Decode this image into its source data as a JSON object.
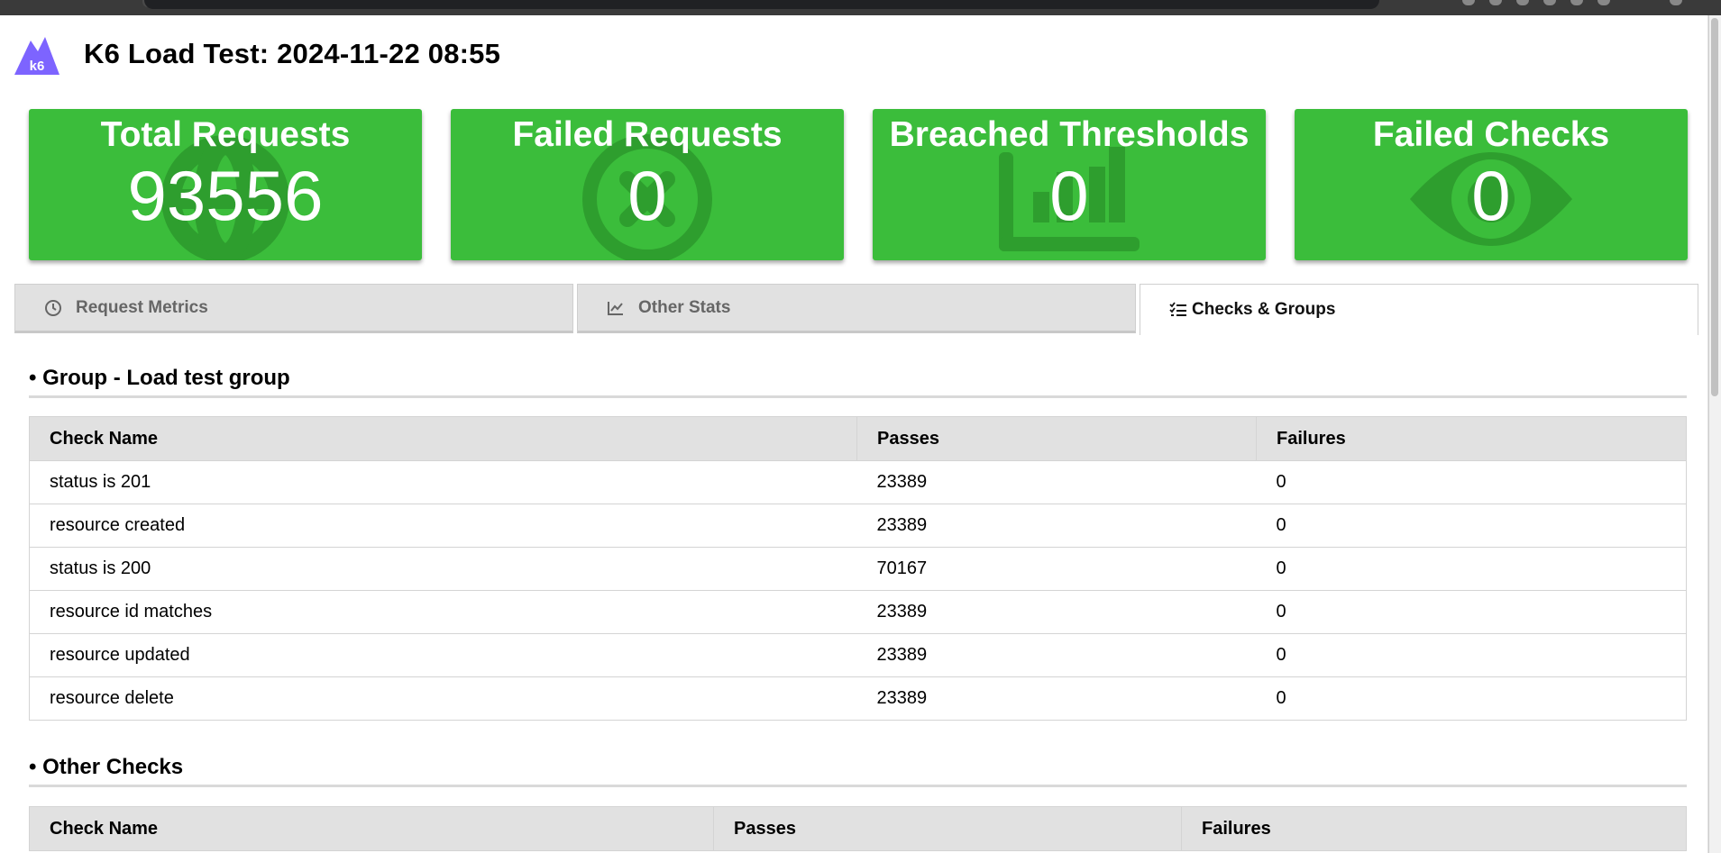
{
  "page": {
    "title": "K6 Load Test: 2024-11-22 08:55",
    "logo_text": "k6"
  },
  "colors": {
    "card_green": "#3bbd3b",
    "logo_purple": "#7d64ff"
  },
  "cards": [
    {
      "title": "Total Requests",
      "value": "93556",
      "icon": "globe-icon"
    },
    {
      "title": "Failed Requests",
      "value": "0",
      "icon": "x-circle-icon"
    },
    {
      "title": "Breached Thresholds",
      "value": "0",
      "icon": "bar-chart-icon"
    },
    {
      "title": "Failed Checks",
      "value": "0",
      "icon": "eye-icon"
    }
  ],
  "tabs": [
    {
      "label": "Request Metrics",
      "icon": "clock-icon",
      "active": false
    },
    {
      "label": "Other Stats",
      "icon": "line-chart-icon",
      "active": false
    },
    {
      "label": "Checks & Groups",
      "icon": "checklist-icon",
      "active": true
    }
  ],
  "group_section": {
    "heading": "• Group - Load test group",
    "columns": [
      "Check Name",
      "Passes",
      "Failures"
    ],
    "rows": [
      [
        "status is 201",
        "23389",
        "0"
      ],
      [
        "resource created",
        "23389",
        "0"
      ],
      [
        "status is 200",
        "70167",
        "0"
      ],
      [
        "resource id matches",
        "23389",
        "0"
      ],
      [
        "resource updated",
        "23389",
        "0"
      ],
      [
        "resource delete",
        "23389",
        "0"
      ]
    ]
  },
  "other_section": {
    "heading": "• Other Checks",
    "columns": [
      "Check Name",
      "Passes",
      "Failures"
    ]
  }
}
